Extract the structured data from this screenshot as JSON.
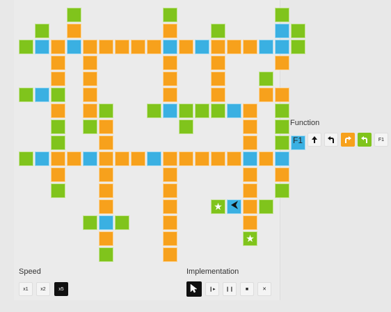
{
  "speed": {
    "label": "Speed",
    "options": [
      {
        "label": "x1",
        "active": false
      },
      {
        "label": "x2",
        "active": false
      },
      {
        "label": "x5",
        "active": true
      }
    ]
  },
  "implementation": {
    "label": "Implementation",
    "buttons": [
      {
        "icon": "cursor-icon",
        "glyph": "",
        "active": true
      },
      {
        "icon": "step-icon",
        "glyph": "❙▸",
        "active": false
      },
      {
        "icon": "pause-icon",
        "glyph": "❙❙",
        "active": false
      },
      {
        "icon": "stop-icon",
        "glyph": "■",
        "active": false
      },
      {
        "icon": "close-icon",
        "glyph": "✕",
        "active": false
      }
    ]
  },
  "function_panel": {
    "title": "Function",
    "name": "F1",
    "slots": [
      {
        "icon": "forward-arrow-icon",
        "color": "none",
        "text": ""
      },
      {
        "icon": "turn-left-icon",
        "color": "none",
        "text": ""
      },
      {
        "icon": "turn-right-icon",
        "color": "orange",
        "text": ""
      },
      {
        "icon": "turn-left-icon",
        "color": "green",
        "text": ""
      },
      {
        "icon": "call-f1-icon",
        "color": "none",
        "text": "F1"
      }
    ]
  },
  "colors": {
    "orange": "#f7a11c",
    "green": "#80c41c",
    "blue": "#3ab0e2"
  },
  "board": {
    "rows": [
      "...g.....g......g.",
      ".g.o.....o..g...bg",
      "gbobooooobobooobbg",
      "..o.o....o..o...o.",
      "..o.o....o..o..g..",
      "gbg.o....o..o..oo.",
      "..o.og..gbgggbo.g.",
      "..g.go....g...o.g.",
      "..g..o........o.gb",
      "gboobooobooooobob.",
      "..o..o...o....o.o.",
      "..g..o...o....o.g.",
      ".....o...o..SRog..",
      "....gbg..o....o...",
      ".....o...o....S...",
      ".....g...o........"
    ],
    "stars": 2,
    "robot_direction": "left"
  }
}
